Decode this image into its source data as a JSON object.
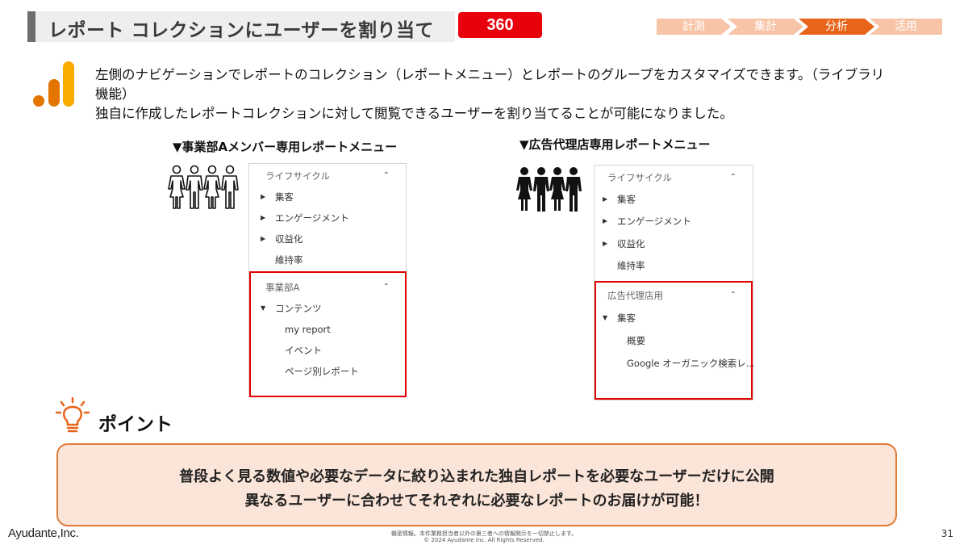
{
  "header": {
    "title": "レポート コレクションにユーザーを割り当て",
    "badge": "360",
    "steps": [
      {
        "label": "計測",
        "active": false
      },
      {
        "label": "集計",
        "active": false
      },
      {
        "label": "分析",
        "active": true
      },
      {
        "label": "活用",
        "active": false
      }
    ],
    "colors": {
      "step_inactive": "#f7c4a8",
      "step_active": "#e8641b",
      "badge": "#e8000c"
    }
  },
  "description": {
    "line1": "左側のナビゲーションでレポートのコレクション（レポートメニュー）とレポートのグループをカスタマイズできます。（ライブラリ",
    "line2": "機能）",
    "line3": "独自に作成したレポートコレクションに対して閲覧できるユーザーを割り当てることが可能になりました。"
  },
  "left_menu": {
    "heading": "▼事業部Aメンバー専用レポートメニュー",
    "people_icon": "people-outline-icon",
    "section1": {
      "title": "ライフサイクル",
      "items": [
        "集客",
        "エンゲージメント",
        "収益化",
        "維持率"
      ]
    },
    "section2": {
      "title": "事業部A",
      "group": "コンテンツ",
      "items": [
        "my report",
        "イベント",
        "ページ別レポート"
      ]
    }
  },
  "right_menu": {
    "heading": "▼広告代理店専用レポートメニュー",
    "people_icon": "people-filled-icon",
    "section1": {
      "title": "ライフサイクル",
      "items": [
        "集客",
        "エンゲージメント",
        "収益化",
        "維持率"
      ]
    },
    "section2": {
      "title": "広告代理店用",
      "group": "集客",
      "items": [
        "概要",
        "Google オーガニック検索レ..."
      ]
    }
  },
  "point": {
    "title": "ポイント",
    "line1": "普段よく見る数値や必要なデータに絞り込まれた独自レポートを必要なユーザーだけに公開",
    "line2": "異なるユーザーに合わせてそれぞれに必要なレポートのお届けが可能！"
  },
  "footer": {
    "logo": "Ayudante,Inc.",
    "note1": "機密情報。本件業務担当者以外の第三者への情報開示を一切禁止します。",
    "note2": "© 2024 Ayudante Inc. All Rights Reserved.",
    "page": "31"
  }
}
